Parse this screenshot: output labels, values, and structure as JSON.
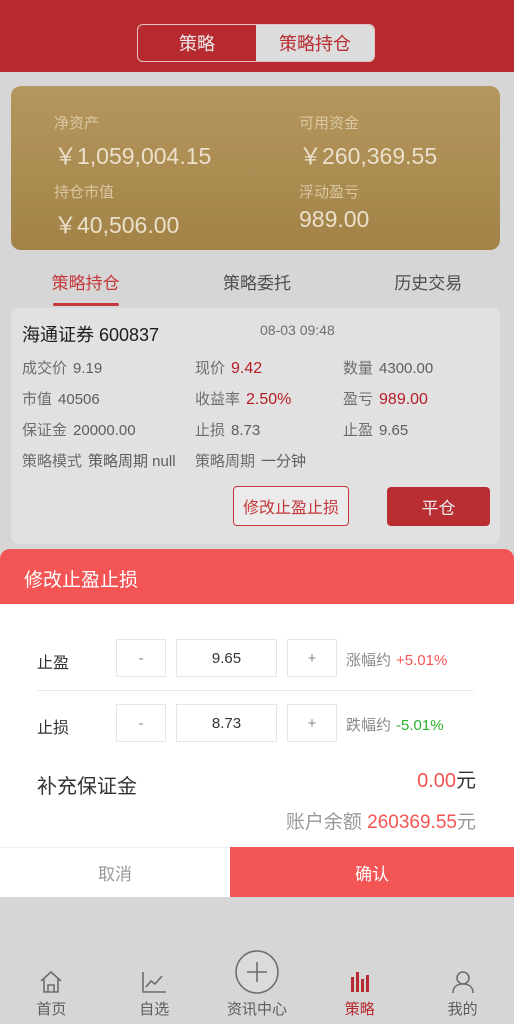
{
  "header": {
    "segments": [
      "策略",
      "策略持仓"
    ],
    "active_segment": "策略持仓"
  },
  "account": {
    "net_assets_label": "净资产",
    "net_assets_value": "￥1,059,004.15",
    "available_label": "可用资金",
    "available_value": "￥260,369.55",
    "position_value_label": "持仓市值",
    "position_value": "￥40,506.00",
    "floating_pl_label": "浮动盈亏",
    "floating_pl_value": "989.00"
  },
  "tabs": [
    {
      "label": "策略持仓",
      "active": true
    },
    {
      "label": "策略委托",
      "active": false
    },
    {
      "label": "历史交易",
      "active": false
    }
  ],
  "position": {
    "stock": "海通证券 600837",
    "time": "08-03 09:48",
    "fields": {
      "deal_price_label": "成交价",
      "deal_price": "9.19",
      "current_price_label": "现价",
      "current_price": "9.42",
      "quantity_label": "数量",
      "quantity": "4300.00",
      "market_value_label": "市值",
      "market_value": "40506",
      "return_rate_label": "收益率",
      "return_rate": "2.50%",
      "pl_label": "盈亏",
      "pl": "989.00",
      "deposit_label": "保证金",
      "deposit": "20000.00",
      "stop_loss_label": "止损",
      "stop_loss": "8.73",
      "take_profit_label": "止盈",
      "take_profit": "9.65",
      "mode_label": "策略模式",
      "mode": "策略周期 null",
      "cycle_label": "策略周期",
      "cycle": "一分钟"
    },
    "modify_button": "修改止盈止损",
    "close_button": "平仓"
  },
  "modal": {
    "title": "修改止盈止损",
    "take_profit": {
      "label": "止盈",
      "minus": "-",
      "value": "9.65",
      "plus": "+",
      "hint_label": "涨幅约",
      "hint_value": "+5.01%"
    },
    "stop_loss": {
      "label": "止损",
      "minus": "-",
      "value": "8.73",
      "plus": "+",
      "hint_label": "跌幅约",
      "hint_value": "-5.01%"
    },
    "margin_label": "补充保证金",
    "margin_value": "0.00",
    "margin_unit": "元",
    "balance_label": "账户余额",
    "balance_value": "260369.55",
    "balance_unit": "元",
    "cancel": "取消",
    "confirm": "确认"
  },
  "colors": {
    "brand_red": "#c72f35",
    "modal_red": "#f35454",
    "gold": "#c4a466",
    "up_red": "#f35454",
    "down_green": "#2bb52b"
  },
  "nav": [
    {
      "label": "首页",
      "icon": "home-icon",
      "active": false
    },
    {
      "label": "自选",
      "icon": "chart-icon",
      "active": false
    },
    {
      "label": "资讯中心",
      "icon": "plus-circle-icon",
      "active": false
    },
    {
      "label": "策略",
      "icon": "strategy-icon",
      "active": true
    },
    {
      "label": "我的",
      "icon": "user-icon",
      "active": false
    }
  ]
}
